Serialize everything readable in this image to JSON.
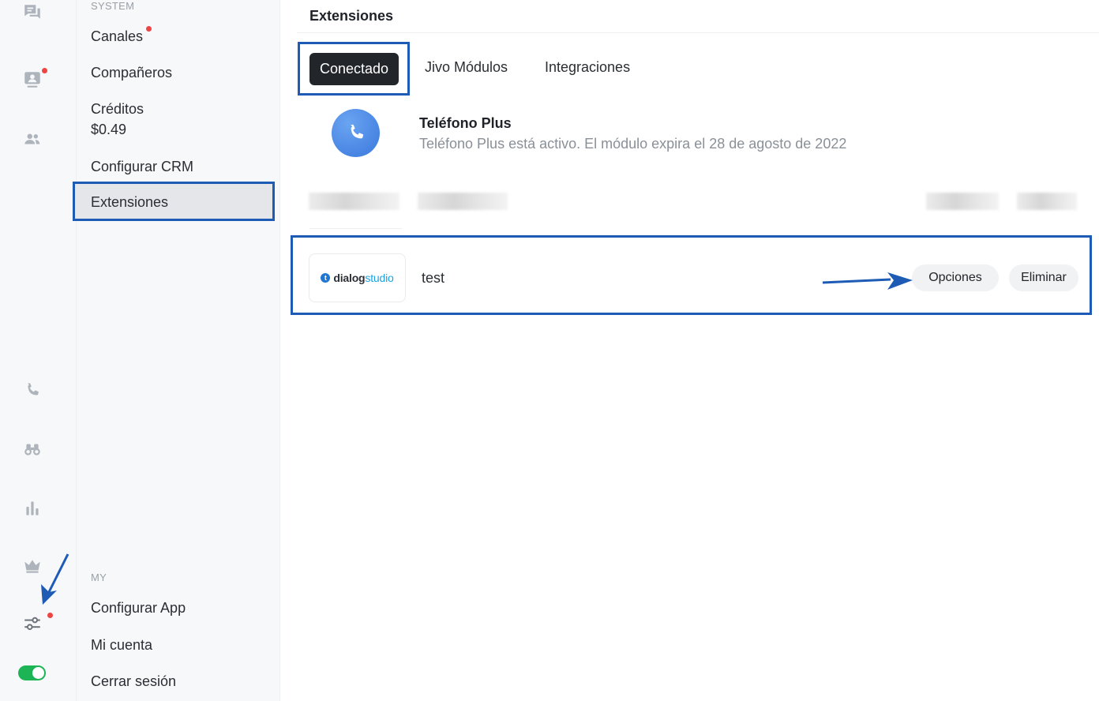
{
  "rail": {
    "icons": [
      {
        "name": "chats-icon"
      },
      {
        "name": "visitors-icon",
        "dot": true
      },
      {
        "name": "team-icon"
      },
      {
        "name": "phone-icon"
      },
      {
        "name": "binoculars-icon"
      },
      {
        "name": "reports-icon"
      },
      {
        "name": "crown-icon"
      },
      {
        "name": "settings-sliders-icon",
        "dot": true
      }
    ],
    "status_toggle": "on"
  },
  "menu": {
    "section_system": "SYSTEM",
    "section_my": "MY",
    "items": {
      "canales": "Canales",
      "companeros": "Compañeros",
      "creditos": "Créditos",
      "creditos_value": "$0.49",
      "configurar_crm": "Configurar CRM",
      "extensiones": "Extensiones",
      "configurar_app": "Configurar App",
      "mi_cuenta": "Mi cuenta",
      "cerrar_sesion": "Cerrar sesión"
    }
  },
  "main": {
    "title": "Extensiones",
    "tabs": {
      "conectado": "Conectado",
      "jivo_modulos": "Jivo Módulos",
      "integraciones": "Integraciones"
    },
    "telefono": {
      "title": "Teléfono Plus",
      "description": "Teléfono Plus está activo. El módulo expira el 28 de agosto de 2022"
    },
    "dialog": {
      "logo_mark": "t",
      "logo_text_a": "dialog",
      "logo_text_b": "studio",
      "name": "test",
      "options_label": "Opciones",
      "delete_label": "Eliminar"
    }
  },
  "colors": {
    "accent_dark": "#22252a",
    "annotation_blue": "#1d5bb5",
    "toggle_green": "#1cb454",
    "notification_red": "#ef4444",
    "phone_blue": "#3a78dd"
  }
}
